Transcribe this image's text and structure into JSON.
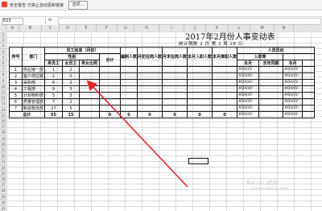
{
  "app": {
    "security_label": "安全警告",
    "notice": "已禁止自动更新链接",
    "options_button": "选项..."
  },
  "formula_bar": {
    "name_box": "E23",
    "fx": "fx",
    "value": ""
  },
  "column_letters": [
    "A",
    "B",
    "C",
    "D",
    "E",
    "F",
    "G",
    "H",
    "I",
    "J",
    "K",
    "L",
    "M",
    "N"
  ],
  "row_numbers": [
    "1",
    "2",
    "3",
    "4",
    "5",
    "6",
    "7",
    "8",
    "9",
    "10",
    "11",
    "12",
    "13",
    "14",
    "15",
    "16",
    "17",
    "18",
    "19",
    "20",
    "21",
    "22",
    "23",
    "24",
    "25",
    "26",
    "27",
    "28",
    "29",
    "30",
    "31"
  ],
  "report": {
    "title": "2017年2月份人事变动表",
    "stat_date": "统计期数 2 月 第 2 周 28 日",
    "headers": {
      "seq": "序号",
      "dept": "部门",
      "staff_info": "员工信息（月初）",
      "gender": "性别",
      "male": "男员工",
      "female": "女员工",
      "ratio": "男女比例",
      "total": "合计",
      "headcount": "编制人数",
      "start_on_job": "月初在岗人数",
      "end_on_job": "月末在岗人数",
      "month_in": "本月入职人数",
      "month_out": "本月离职人数",
      "movement": "人员异动",
      "entry_rate": "入职率",
      "this_month": "本月",
      "same_period": "去年同期"
    },
    "rows": [
      {
        "seq": "1",
        "dept": "供应链一部",
        "male": "1",
        "female": "2",
        "ratio": "",
        "total": "",
        "headcount": "",
        "start": "",
        "end": "",
        "in": "",
        "out": "",
        "this_month": "#DIV/0!",
        "same_period": "",
        "next": "#DIV/0!"
      },
      {
        "seq": "2",
        "dept": "客户供应链",
        "male": "1",
        "female": "0",
        "ratio": "",
        "total": "",
        "headcount": "",
        "start": "",
        "end": "",
        "in": "",
        "out": "",
        "this_month": "#DIV/0!",
        "same_period": "",
        "next": "#DIV/0!"
      },
      {
        "seq": "3",
        "dept": "采购部",
        "male": "6",
        "female": "2",
        "ratio": "",
        "total": "",
        "headcount": "",
        "start": "",
        "end": "",
        "in": "",
        "out": "",
        "this_month": "#DIV/0!",
        "same_period": "",
        "next": "#DIV/0!"
      },
      {
        "seq": "4",
        "dept": "工程部",
        "male": "9",
        "female": "3",
        "ratio": "",
        "total": "",
        "headcount": "",
        "start": "",
        "end": "",
        "in": "",
        "out": "",
        "this_month": "#DIV/0!",
        "same_period": "",
        "next": "#DIV/0!"
      },
      {
        "seq": "5",
        "dept": "计划物料部",
        "male": "5",
        "female": "3",
        "ratio": "",
        "total": "",
        "headcount": "",
        "start": "",
        "end": "",
        "in": "",
        "out": "",
        "this_month": "#DIV/0!",
        "same_period": "",
        "next": "#DIV/0!"
      },
      {
        "seq": "6",
        "dept": "质量管理部",
        "male": "7",
        "female": "2",
        "ratio": "",
        "total": "",
        "headcount": "",
        "start": "",
        "end": "",
        "in": "",
        "out": "",
        "this_month": "#DIV/0!",
        "same_period": "",
        "next": "#DIV/0!"
      },
      {
        "seq": "7",
        "dept": "制造物流部",
        "male": "27",
        "female": "5",
        "ratio": "",
        "total": "",
        "headcount": "",
        "start": "",
        "end": "",
        "in": "",
        "out": "",
        "this_month": "#DIV/0!",
        "same_period": "",
        "next": "#DIV/0!"
      }
    ],
    "totals": {
      "label": "总计",
      "male": "55",
      "female": "15",
      "ratio": "",
      "total": "0",
      "headcount": "0",
      "start": "0",
      "end": "0",
      "in": "0",
      "out": "0",
      "this_month": "#DIV/0!",
      "same_period": "",
      "next": "#DIV/0!"
    }
  },
  "watermark": {
    "line1": "Bai du 经验",
    "line2": "jingyan.baidu.com"
  },
  "colors": {
    "arrow": "#e2242a",
    "grid": "#dadada",
    "header_bg": "#e6e6e6"
  }
}
